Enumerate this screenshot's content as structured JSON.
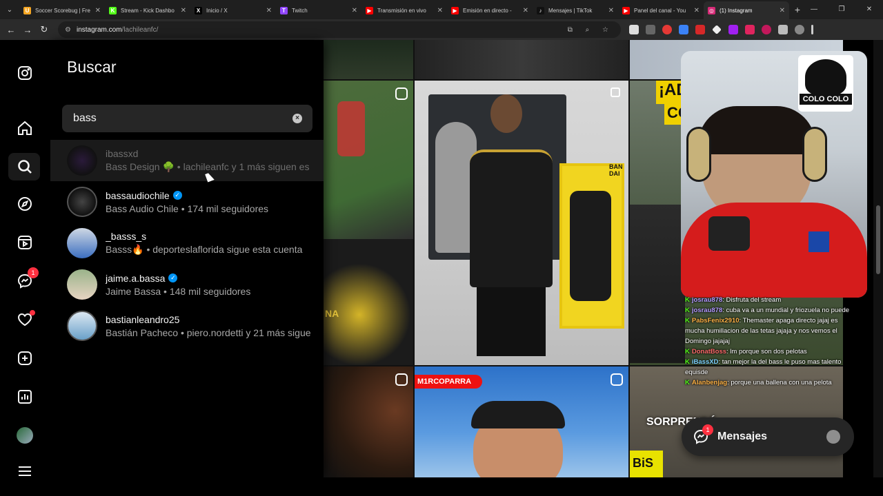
{
  "browser": {
    "tabs": [
      {
        "title": "Soccer Scorebug | Fre",
        "icon": "scorebug-icon",
        "color": "#f5a623",
        "glyph": "U"
      },
      {
        "title": "Stream - Kick Dashbo",
        "icon": "kick-icon",
        "color": "#53fc18",
        "glyph": "K"
      },
      {
        "title": "Inicio / X",
        "icon": "x-icon",
        "color": "#000000",
        "glyph": "X"
      },
      {
        "title": "Twitch",
        "icon": "twitch-icon",
        "color": "#9146ff",
        "glyph": "T"
      },
      {
        "title": "Transmisión en vivo",
        "icon": "youtube-icon",
        "color": "#ff0000",
        "glyph": "▶"
      },
      {
        "title": "Emisión en directo -",
        "icon": "youtube-icon",
        "color": "#ff0000",
        "glyph": "▶"
      },
      {
        "title": "Mensajes | TikTok",
        "icon": "tiktok-icon",
        "color": "#111111",
        "glyph": "♪"
      },
      {
        "title": "Panel del canal - You",
        "icon": "youtube-icon",
        "color": "#ff0000",
        "glyph": "▶"
      },
      {
        "title": "(1) Instagram",
        "icon": "instagram-icon",
        "color": "#d62976",
        "glyph": "◎"
      }
    ],
    "url_host": "instagram.com",
    "url_path": "/lachileanfc/"
  },
  "search": {
    "title": "Buscar",
    "query": "bass",
    "results": [
      {
        "username": "ibassxd",
        "subtitle": "Bass Design 🌳 • lachileanfc y 1 más siguen es",
        "verified": false
      },
      {
        "username": "bassaudiochile",
        "subtitle": "Bass Audio Chile • 174 mil seguidores",
        "verified": true
      },
      {
        "username": "_basss_s",
        "subtitle": "Basss🔥 • deporteslaflorida sigue esta cuenta",
        "verified": false
      },
      {
        "username": "jaime.a.bassa",
        "subtitle": "Jaime Bassa • 148 mil seguidores",
        "verified": true
      },
      {
        "username": "bastianleandro25",
        "subtitle": "Bastián Pacheco • piero.nordetti y 21 más sigue",
        "verified": false
      }
    ]
  },
  "sidebar": {
    "notifications_badge": "1"
  },
  "feed": {
    "tile_labels": [
      "¡AD",
      "CO",
      "M1RCOPARRA",
      "SORPRENDÉ",
      "BiS",
      "NA",
      "BAN DAI"
    ]
  },
  "stream_overlay": {
    "team_badge": "COLO COLO",
    "chat": [
      {
        "user": "josrau878",
        "text": ": Disfruta del stream"
      },
      {
        "user": "josrau878",
        "text": ": cuba va a un mundial y friozuela no puede"
      },
      {
        "user": "PabsFenix2910",
        "text": ": Themaster apaga directo jajaj es mucha humillacion de las tetas jajaja y nos vemos el Domingo jajajaj"
      },
      {
        "user": "DonatBoss",
        "text": ": lm porque son dos pelotas"
      },
      {
        "user": "iBassXD",
        "text": ": tan mejor la del bass le puso mas talento equisde"
      },
      {
        "user": "Alanbenjag",
        "text": ": porque una ballena con una pelota"
      }
    ]
  },
  "messages": {
    "label": "Mensajes",
    "badge": "1"
  }
}
